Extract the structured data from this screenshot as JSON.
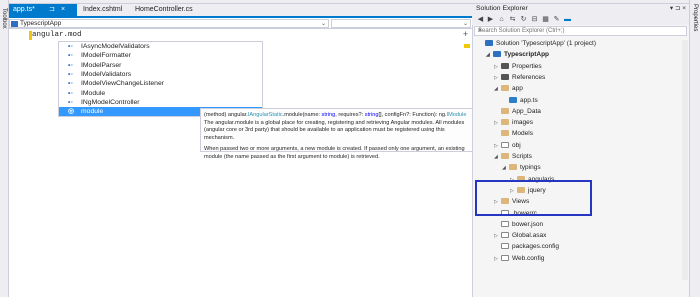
{
  "side_strips": {
    "left_label": "Toolbox",
    "right_label": "Properties"
  },
  "tabs": [
    {
      "label": "app.ts*",
      "pin": "⊐",
      "close": "×"
    },
    {
      "label": "Index.cshtml"
    },
    {
      "label": "HomeController.cs"
    }
  ],
  "navbar": {
    "project": "TypescriptApp",
    "member": ""
  },
  "editor": {
    "code_line": "angular.mod"
  },
  "completion": {
    "items": [
      {
        "icon": "interface-icon",
        "glyph": "•◦",
        "label": "IAsyncModelValidators"
      },
      {
        "icon": "interface-icon",
        "glyph": "•◦",
        "label": "IModelFormatter"
      },
      {
        "icon": "interface-icon",
        "glyph": "•◦",
        "label": "IModelParser"
      },
      {
        "icon": "interface-icon",
        "glyph": "•◦",
        "label": "IModelValidators"
      },
      {
        "icon": "interface-icon",
        "glyph": "•◦",
        "label": "IModelViewChangeListener"
      },
      {
        "icon": "interface-icon",
        "glyph": "•◦",
        "label": "IModule"
      },
      {
        "icon": "interface-icon",
        "glyph": "•◦",
        "label": "INgModelController"
      },
      {
        "icon": "method-icon",
        "glyph": "◎",
        "label": "module"
      }
    ],
    "selected_index": 7
  },
  "tooltip": {
    "sig_prefix": "(method) angular.",
    "sig_type": "IAngularStatic",
    "sig_name": ".module(name: ",
    "sig_t1": "string",
    "sig_mid": ", requires?: ",
    "sig_t2": "string",
    "sig_mid2": "[], configFn?: Function): ng.",
    "sig_ret": "IModule",
    "desc1": "The angular.module is a global place for creating, registering and retrieving Angular modules. All modules (angular core or 3rd party) that should be available to an application must be registered using this mechanism.",
    "desc2": "When passed two or more arguments, a new module is created. If passed only one argument, an existing module (the name passed as the first argument to module) is retrieved."
  },
  "solution_explorer": {
    "title": "Solution Explorer",
    "window_controls": "▾ ⊐ ×",
    "search_placeholder": "Search Solution Explorer (Ctrl+;)",
    "toolbar_icons": [
      "back-icon",
      "forward-icon",
      "home-icon",
      "sync-icon",
      "refresh-icon",
      "collapse-icon",
      "show-all-icon",
      "properties-icon",
      "preview-icon"
    ],
    "tree": [
      {
        "label": "Solution 'TypescriptApp' (1 project)",
        "indent": 0,
        "expander": "",
        "icon": "solution",
        "bold": false
      },
      {
        "label": "TypescriptApp",
        "indent": 1,
        "expander": "◢",
        "icon": "proj",
        "bold": true
      },
      {
        "label": "Properties",
        "indent": 2,
        "expander": "▷",
        "icon": "refs",
        "bold": false
      },
      {
        "label": "References",
        "indent": 2,
        "expander": "▷",
        "icon": "refs",
        "bold": false
      },
      {
        "label": "app",
        "indent": 2,
        "expander": "◢",
        "icon": "folder",
        "bold": false
      },
      {
        "label": "app.ts",
        "indent": 3,
        "expander": "",
        "icon": "ts",
        "bold": false
      },
      {
        "label": "App_Data",
        "indent": 2,
        "expander": "",
        "icon": "folder",
        "bold": false
      },
      {
        "label": "images",
        "indent": 2,
        "expander": "▷",
        "icon": "folder",
        "bold": false
      },
      {
        "label": "Models",
        "indent": 2,
        "expander": "",
        "icon": "folder",
        "bold": false
      },
      {
        "label": "obj",
        "indent": 2,
        "expander": "▷",
        "icon": "file",
        "bold": false
      },
      {
        "label": "Scripts",
        "indent": 2,
        "expander": "◢",
        "icon": "folder",
        "bold": false
      },
      {
        "label": "typings",
        "indent": 3,
        "expander": "◢",
        "icon": "folder",
        "bold": false
      },
      {
        "label": "angularjs",
        "indent": 4,
        "expander": "▷",
        "icon": "folder",
        "bold": false
      },
      {
        "label": "jquery",
        "indent": 4,
        "expander": "▷",
        "icon": "folder",
        "bold": false
      },
      {
        "label": "Views",
        "indent": 2,
        "expander": "▷",
        "icon": "folder",
        "bold": false
      },
      {
        "label": ".bowerrc",
        "indent": 2,
        "expander": "",
        "icon": "file",
        "bold": false
      },
      {
        "label": "bower.json",
        "indent": 2,
        "expander": "",
        "icon": "file",
        "bold": false
      },
      {
        "label": "Global.asax",
        "indent": 2,
        "expander": "▷",
        "icon": "file",
        "bold": false
      },
      {
        "label": "packages.config",
        "indent": 2,
        "expander": "",
        "icon": "file",
        "bold": false
      },
      {
        "label": "Web.config",
        "indent": 2,
        "expander": "▷",
        "icon": "file",
        "bold": false
      }
    ]
  },
  "colors": {
    "accent": "#007acc",
    "selection": "#3399ff",
    "highlight_box": "#2436c2"
  }
}
